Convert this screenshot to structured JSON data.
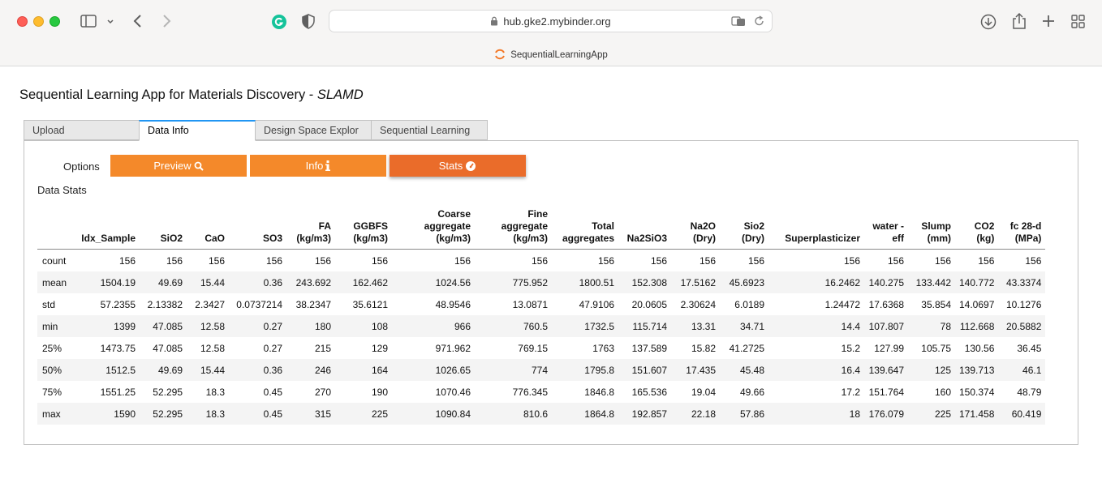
{
  "browser": {
    "url": "hub.gke2.mybinder.org",
    "tab_title": "SequentialLearningApp"
  },
  "app": {
    "title": "Sequential Learning App for Materials Discovery - ",
    "title_emph": "SLAMD"
  },
  "tabs": [
    "Upload",
    "Data Info",
    "Design Space Explor",
    "Sequential Learning"
  ],
  "active_tab": "Data Info",
  "options": {
    "label": "Options",
    "preview": "Preview",
    "info": "Info",
    "stats": "Stats"
  },
  "section_title": "Data Stats",
  "colors": {
    "button": "#f4892a",
    "button_selected": "#ea6c2a",
    "tab_accent": "#2196f3"
  },
  "stats_table": {
    "columns": [
      "",
      "Idx_Sample",
      "SiO2",
      "CaO",
      "SO3",
      "FA (kg/m3)",
      "GGBFS (kg/m3)",
      "Coarse aggregate (kg/m3)",
      "Fine aggregate (kg/m3)",
      "Total aggregates",
      "Na2SiO3",
      "Na2O (Dry)",
      "Sio2 (Dry)",
      "Superplasticizer",
      "water - eff",
      "Slump (mm)",
      "CO2 (kg)",
      "fc 28-d (MPa)"
    ],
    "rows": [
      [
        "count",
        "156",
        "156",
        "156",
        "156",
        "156",
        "156",
        "156",
        "156",
        "156",
        "156",
        "156",
        "156",
        "156",
        "156",
        "156",
        "156",
        "156"
      ],
      [
        "mean",
        "1504.19",
        "49.69",
        "15.44",
        "0.36",
        "243.692",
        "162.462",
        "1024.56",
        "775.952",
        "1800.51",
        "152.308",
        "17.5162",
        "45.6923",
        "16.2462",
        "140.275",
        "133.442",
        "140.772",
        "43.3374"
      ],
      [
        "std",
        "57.2355",
        "2.13382",
        "2.3427",
        "0.0737214",
        "38.2347",
        "35.6121",
        "48.9546",
        "13.0871",
        "47.9106",
        "20.0605",
        "2.30624",
        "6.0189",
        "1.24472",
        "17.6368",
        "35.854",
        "14.0697",
        "10.1276"
      ],
      [
        "min",
        "1399",
        "47.085",
        "12.58",
        "0.27",
        "180",
        "108",
        "966",
        "760.5",
        "1732.5",
        "115.714",
        "13.31",
        "34.71",
        "14.4",
        "107.807",
        "78",
        "112.668",
        "20.5882"
      ],
      [
        "25%",
        "1473.75",
        "47.085",
        "12.58",
        "0.27",
        "215",
        "129",
        "971.962",
        "769.15",
        "1763",
        "137.589",
        "15.82",
        "41.2725",
        "15.2",
        "127.99",
        "105.75",
        "130.56",
        "36.45"
      ],
      [
        "50%",
        "1512.5",
        "49.69",
        "15.44",
        "0.36",
        "246",
        "164",
        "1026.65",
        "774",
        "1795.8",
        "151.607",
        "17.435",
        "45.48",
        "16.4",
        "139.647",
        "125",
        "139.713",
        "46.1"
      ],
      [
        "75%",
        "1551.25",
        "52.295",
        "18.3",
        "0.45",
        "270",
        "190",
        "1070.46",
        "776.345",
        "1846.8",
        "165.536",
        "19.04",
        "49.66",
        "17.2",
        "151.764",
        "160",
        "150.374",
        "48.79"
      ],
      [
        "max",
        "1590",
        "52.295",
        "18.3",
        "0.45",
        "315",
        "225",
        "1090.84",
        "810.6",
        "1864.8",
        "192.857",
        "22.18",
        "57.86",
        "18",
        "176.079",
        "225",
        "171.458",
        "60.419"
      ]
    ]
  }
}
